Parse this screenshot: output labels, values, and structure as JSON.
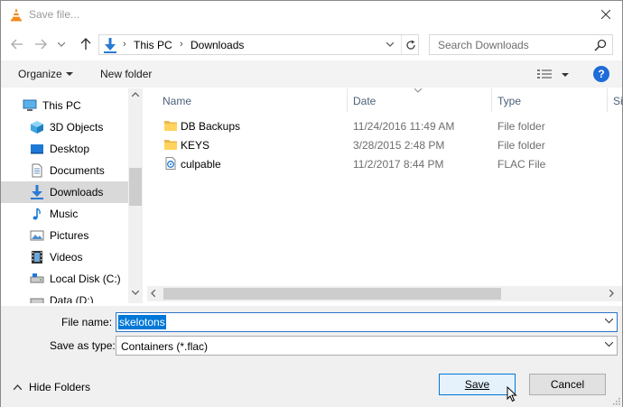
{
  "window": {
    "title": "Save file...",
    "icons": {
      "app": "vlc-cone-icon",
      "close": "close-icon"
    }
  },
  "nav": {
    "icons": {
      "back": "arrow-left-icon",
      "forward": "arrow-right-icon",
      "recent": "chevron-down-icon",
      "up": "arrow-up-icon"
    },
    "address": {
      "segments": [
        "This PC",
        "Downloads"
      ],
      "icon": "downloads-icon"
    },
    "search": {
      "placeholder": "Search Downloads"
    }
  },
  "toolbar": {
    "organize_label": "Organize",
    "new_folder_label": "New folder",
    "help_label": "?"
  },
  "sidebar": {
    "items": [
      {
        "label": "This PC",
        "icon": "monitor-icon",
        "selected": false
      },
      {
        "label": "3D Objects",
        "icon": "cube-icon",
        "selected": false
      },
      {
        "label": "Desktop",
        "icon": "desktop-icon",
        "selected": false
      },
      {
        "label": "Documents",
        "icon": "document-icon",
        "selected": false
      },
      {
        "label": "Downloads",
        "icon": "downloads-icon",
        "selected": true
      },
      {
        "label": "Music",
        "icon": "music-note-icon",
        "selected": false
      },
      {
        "label": "Pictures",
        "icon": "pictures-icon",
        "selected": false
      },
      {
        "label": "Videos",
        "icon": "film-icon",
        "selected": false
      },
      {
        "label": "Local Disk (C:)",
        "icon": "drive-icon",
        "selected": false
      },
      {
        "label": "Data (D:)",
        "icon": "drive-icon",
        "selected": false
      }
    ]
  },
  "files": {
    "columns": [
      "Name",
      "Date",
      "Type",
      "Si"
    ],
    "rows": [
      {
        "name": "DB Backups",
        "date": "11/24/2016 11:49 AM",
        "type": "File folder",
        "icon": "folder-icon"
      },
      {
        "name": "KEYS",
        "date": "3/28/2015 2:48 PM",
        "type": "File folder",
        "icon": "folder-icon"
      },
      {
        "name": "culpable",
        "date": "11/2/2017 8:44 PM",
        "type": "FLAC File",
        "icon": "audio-file-icon"
      }
    ]
  },
  "form": {
    "file_name_label": "File name:",
    "file_name_value": "skelotons",
    "save_type_label": "Save as type:",
    "save_type_value": "Containers (*.flac)",
    "hide_folders_label": "Hide Folders",
    "save_label": "Save",
    "cancel_label": "Cancel"
  },
  "colors": {
    "accent": "#0078d7",
    "selection_bg": "#d9d9d9",
    "header_text": "#4c607a",
    "folder_yellow": "#ffd35c"
  }
}
